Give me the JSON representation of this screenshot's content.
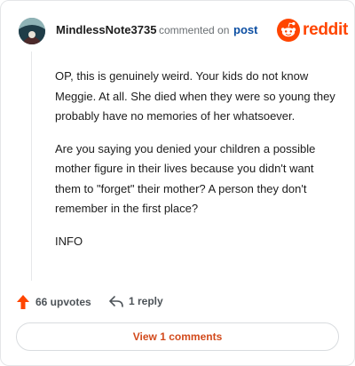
{
  "comment": {
    "author": "MindlessNote3735",
    "action_text": "commented on",
    "post_link_label": "post",
    "brand_name": "reddit",
    "paragraphs": [
      "OP, this is genuinely weird. Your kids do not know Meggie. At all. She died when they were so young they probably have no memories of her whatsoever.",
      "Are you saying you denied your children a possible mother figure in their lives because you didn't want them to \"forget\" their mother? A person they don't remember in the first place?",
      "INFO"
    ],
    "upvotes_label": "66 upvotes",
    "replies_label": "1 reply",
    "view_comments_label": "View 1 comments"
  },
  "colors": {
    "brand_orange": "#ff4500",
    "link_blue": "#0b4ea2",
    "view_button_text": "#d24a1c",
    "upvote_icon": "#ff4500"
  },
  "icons": {
    "avatar": "avatar-image",
    "brand_logo": "reddit-snoo-icon",
    "upvote": "upvote-arrow-icon",
    "reply": "reply-arrow-icon"
  }
}
